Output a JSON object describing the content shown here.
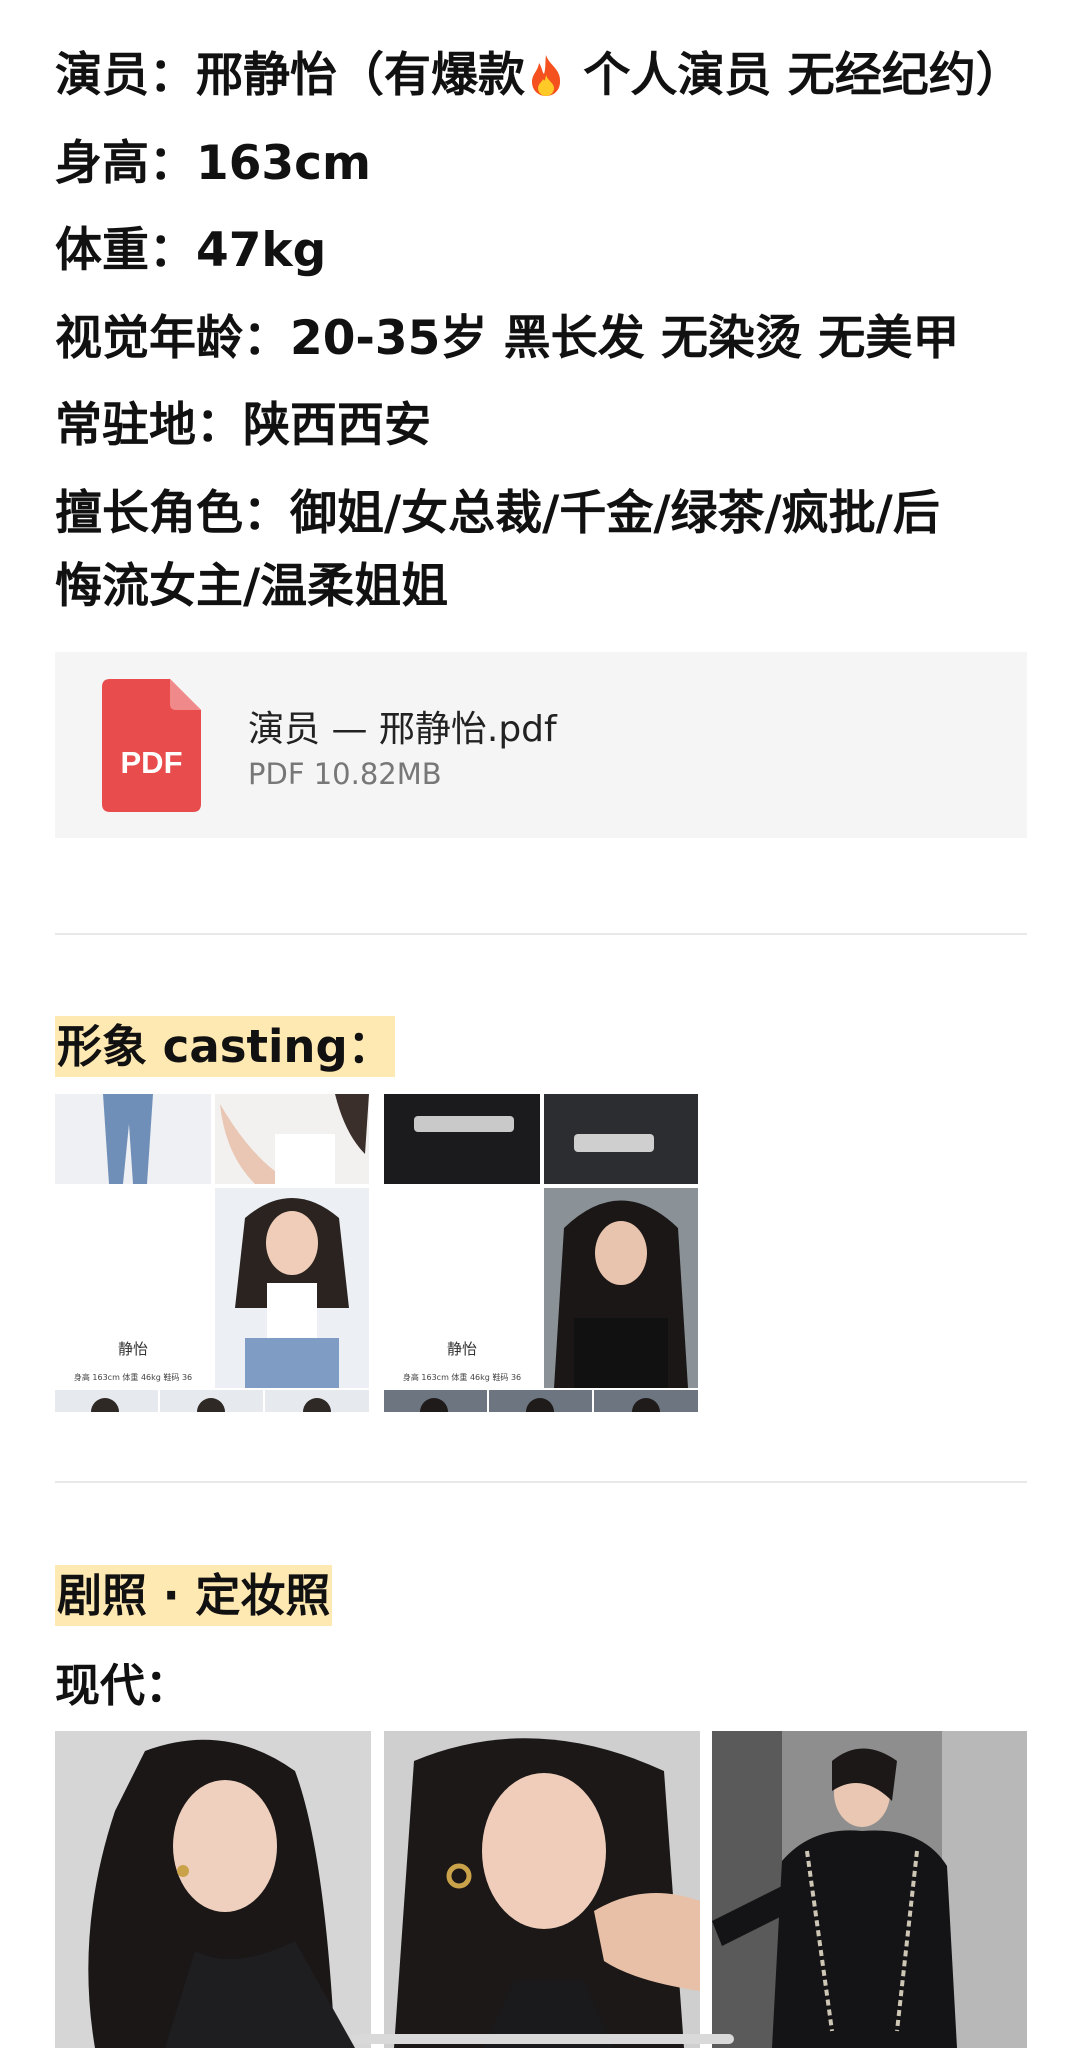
{
  "profile": {
    "actor_label": "演员：",
    "actor_name": "邢静怡",
    "actor_note_pre": "（有爆款",
    "actor_note_post": " 个人演员 无经纪约）",
    "height": "身高：163cm",
    "weight": "体重：47kg",
    "visual": "视觉年龄：20-35岁  黑长发 无染烫 无美甲",
    "base": "常驻地：陕西西安",
    "roles_line1": "擅长角色：御姐/女总裁/千金/绿茶/疯批/后",
    "roles_line2": "悔流女主/温柔姐姐"
  },
  "attachment": {
    "icon_label": "PDF",
    "file_name": "演员 — 邢静怡.pdf",
    "file_meta": "PDF 10.82MB"
  },
  "casting": {
    "title": "形象 casting：",
    "cards": [
      {
        "name": "静怡",
        "stats": "身高 163cm   体重 46kg   鞋码 36"
      },
      {
        "name": "静怡",
        "stats": "身高 163cm   体重 46kg   鞋码 36"
      }
    ]
  },
  "stills": {
    "title": "剧照 · 定妆照",
    "subtitle": "现代："
  },
  "colors": {
    "highlight": "#ffe9b3",
    "pdf_red": "#e84c4c",
    "card_bg": "#f5f5f5"
  }
}
